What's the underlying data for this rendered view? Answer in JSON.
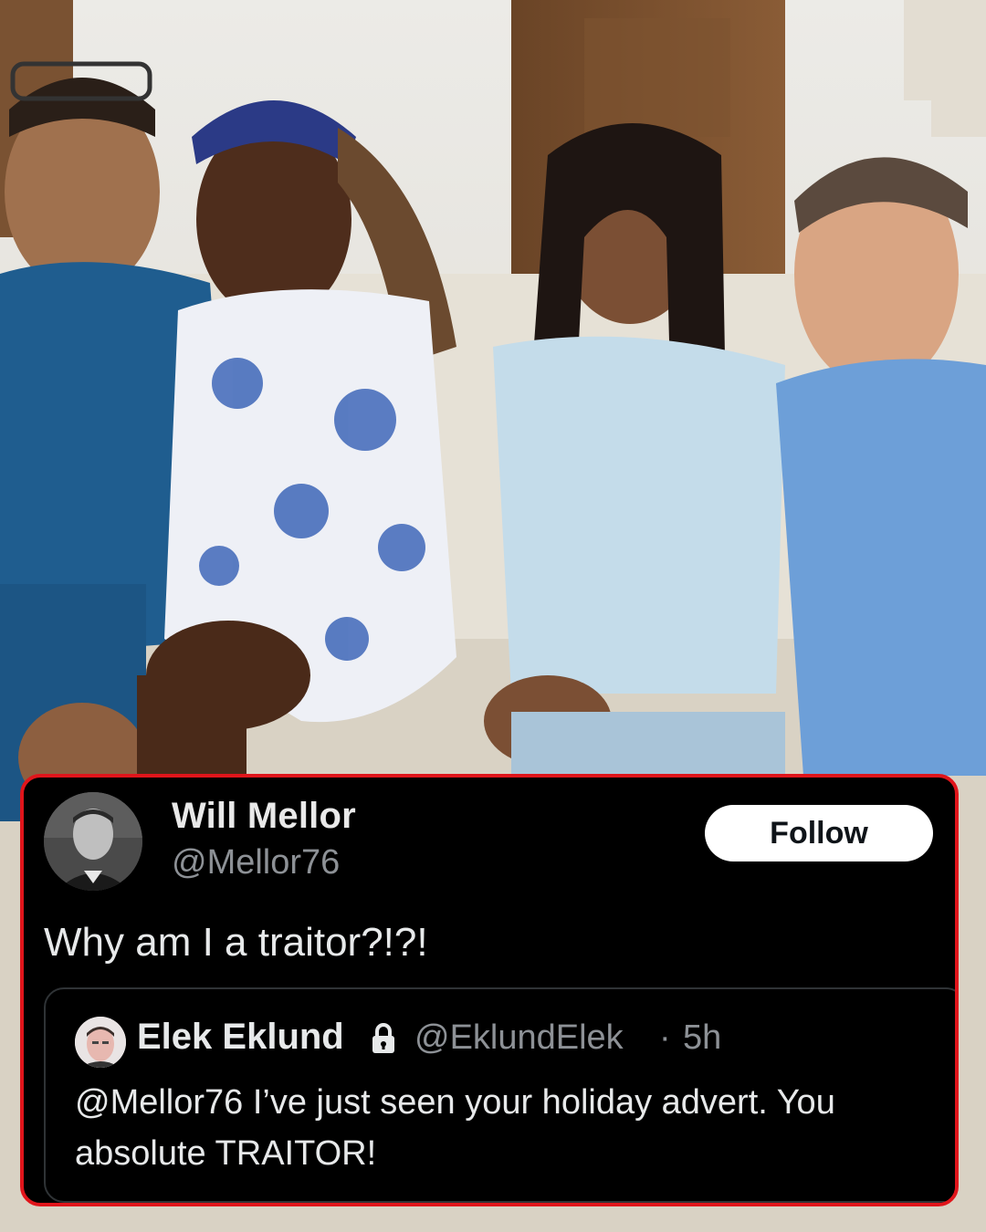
{
  "tweet": {
    "author": {
      "name": "Will Mellor",
      "handle": "@Mellor76",
      "avatar_icon": "profile-photo"
    },
    "follow_label": "Follow",
    "text": "Why am I a traitor?!?!",
    "quoted": {
      "name": "Elek Eklund",
      "protected_icon": "lock-icon",
      "handle": "@EklundElek",
      "separator": "·",
      "time": "5h",
      "text": "@Mellor76 I’ve just seen your holiday advert. You absolute TRAITOR!"
    }
  },
  "colors": {
    "card_background": "#000000",
    "card_border": "#e0151b",
    "text_primary": "#e7e9ea",
    "text_secondary": "#8d9196",
    "follow_button_bg": "#ffffff"
  }
}
